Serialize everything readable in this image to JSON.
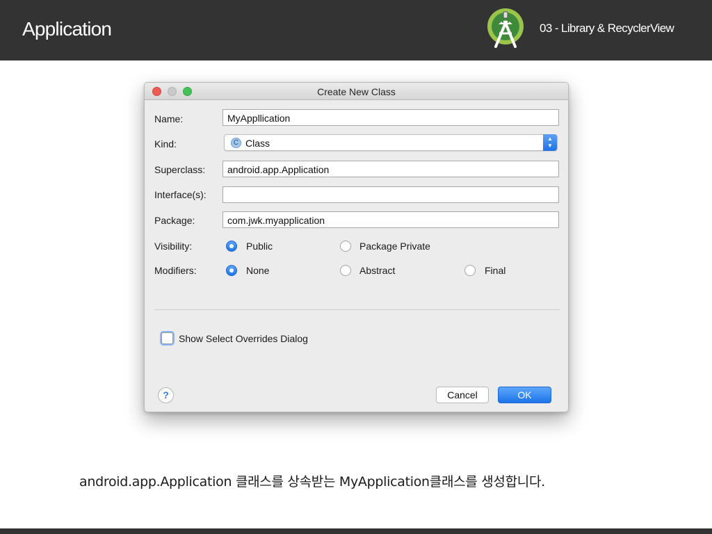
{
  "header": {
    "title": "Application",
    "subtitle": "03 - Library & RecyclerView",
    "logo_icon": "android-studio-icon",
    "background_color": "#333333"
  },
  "dialog": {
    "title": "Create New Class",
    "name": {
      "label": "Name:",
      "value": "MyAppllication"
    },
    "kind": {
      "label": "Kind:",
      "value": "Class",
      "badge": "C"
    },
    "superclass": {
      "label": "Superclass:",
      "value": "android.app.Application"
    },
    "interfaces": {
      "label": "Interface(s):",
      "value": ""
    },
    "package": {
      "label": "Package:",
      "value": "com.jwk.myapplication"
    },
    "visibility": {
      "label": "Visibility:",
      "options": [
        {
          "label": "Public",
          "selected": true
        },
        {
          "label": "Package Private",
          "selected": false
        }
      ]
    },
    "modifiers": {
      "label": "Modifiers:",
      "options": [
        {
          "label": "None",
          "selected": true
        },
        {
          "label": "Abstract",
          "selected": false
        },
        {
          "label": "Final",
          "selected": false
        }
      ]
    },
    "show_overrides": {
      "label": "Show Select Overrides Dialog",
      "checked": false
    },
    "help_label": "?",
    "cancel_label": "Cancel",
    "ok_label": "OK",
    "accent_color": "#1d74ea"
  },
  "caption": "android.app.Application 클래스를 상속받는 MyApplication클래스를 생성합니다."
}
